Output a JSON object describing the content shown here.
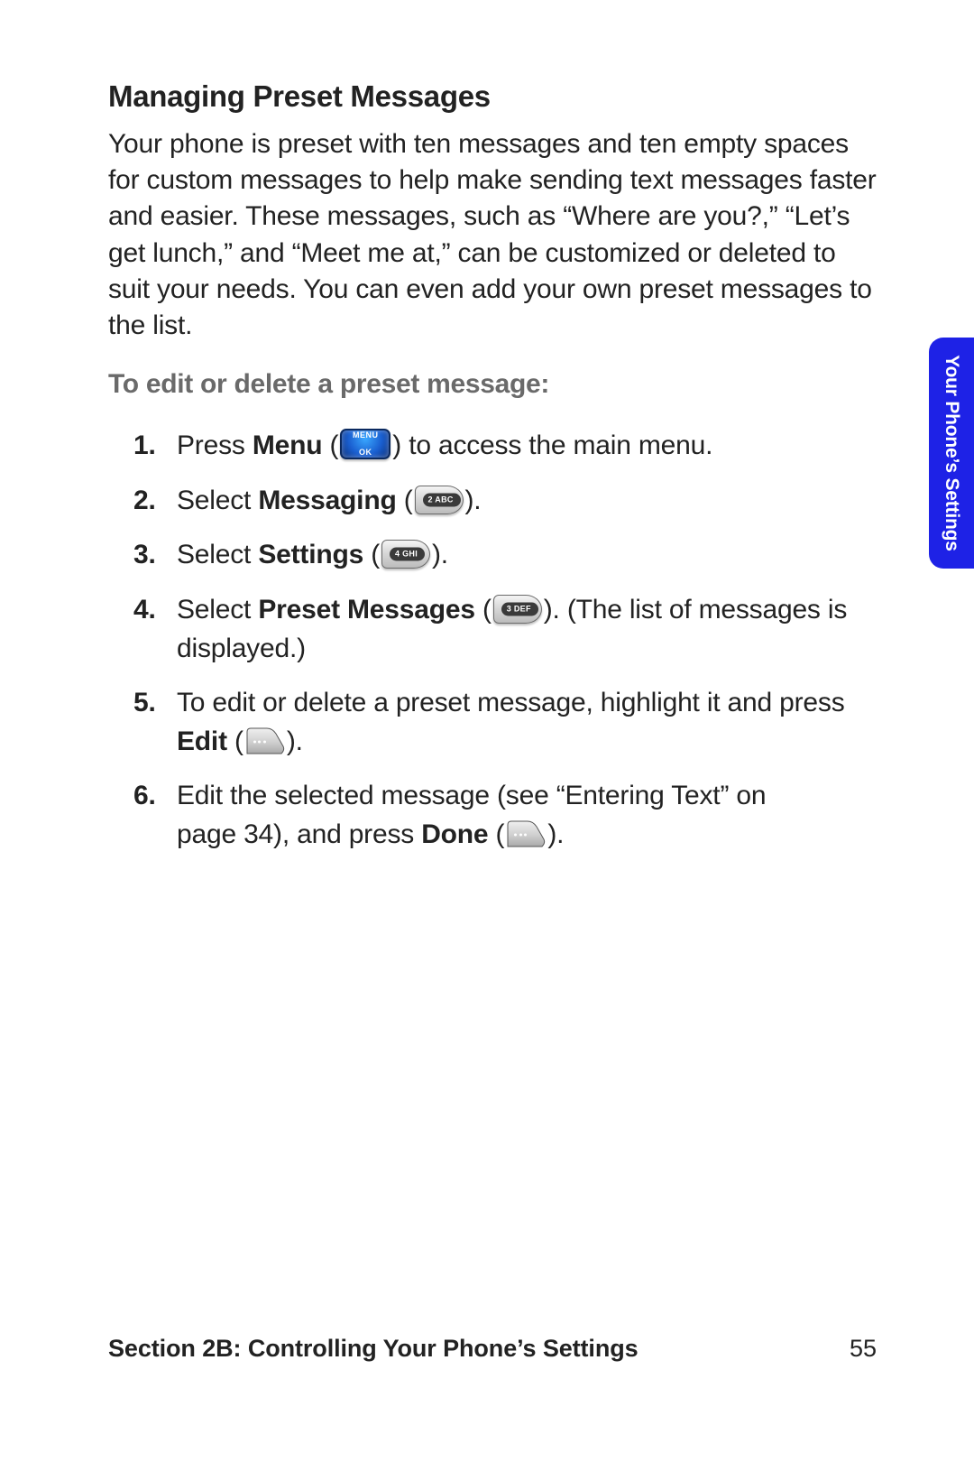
{
  "heading": "Managing Preset Messages",
  "intro": "Your phone is preset with ten messages and ten empty spaces for custom messages to help make sending text messages faster and easier. These messages, such as “Where are you?,” “Let’s get lunch,” and “Meet me at,” can be customized or deleted to suit your needs. You can even add your own preset messages to the list.",
  "subhead": "To edit or delete a preset message:",
  "steps": [
    {
      "num": "1.",
      "pre": "Press ",
      "bold": "Menu",
      "open": " (",
      "key": {
        "type": "menu",
        "line1": "MENU",
        "line2": "OK"
      },
      "post": ") to access the main menu."
    },
    {
      "num": "2.",
      "pre": "Select ",
      "bold": "Messaging",
      "open": " (",
      "key": {
        "type": "gray",
        "label": "2 ABC"
      },
      "post": ")."
    },
    {
      "num": "3.",
      "pre": "Select ",
      "bold": "Settings",
      "open": " (",
      "key": {
        "type": "gray",
        "label": "4 GHI"
      },
      "post": ")."
    },
    {
      "num": "4.",
      "pre": "Select ",
      "bold": "Preset Messages",
      "open": " (",
      "key": {
        "type": "gray",
        "label": "3 DEF"
      },
      "post": "). (The list of messages is displayed.)"
    },
    {
      "num": "5.",
      "line1": "To edit or delete a preset message, highlight it and press",
      "bold": "Edit",
      "open": " (",
      "key": {
        "type": "soft"
      },
      "post": ")."
    },
    {
      "num": "6.",
      "line1": "Edit the selected message (see “Entering Text” on",
      "line2pre": "page 34), and press ",
      "bold": "Done",
      "open": " (",
      "key": {
        "type": "soft"
      },
      "post": ")."
    }
  ],
  "side_tab": "Your Phone’s Settings",
  "footer": {
    "section": "Section 2B: Controlling Your Phone’s Settings",
    "page": "55"
  }
}
